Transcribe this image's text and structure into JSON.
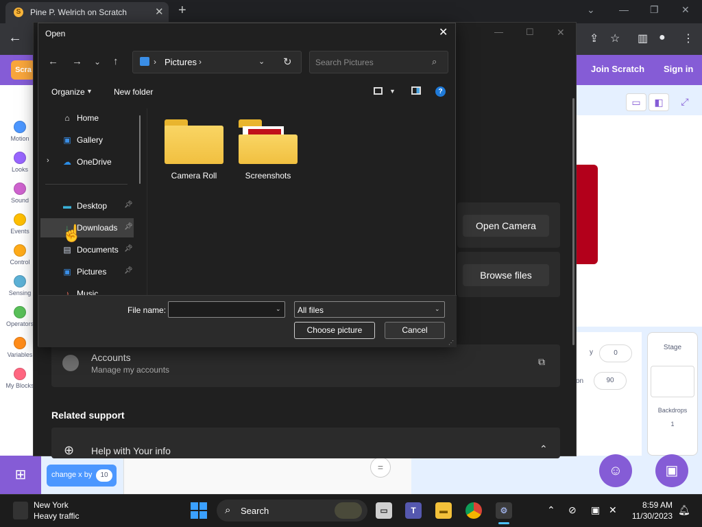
{
  "browser": {
    "tab_title": "Pine P. Welrich on Scratch",
    "favicon": "S",
    "new_tab": "+",
    "close_tab": "✕"
  },
  "scratch": {
    "join": "Join Scratch",
    "signin": "Sign in",
    "logo": "Scra",
    "categories": [
      {
        "label": "Motion",
        "color": "#4c97ff"
      },
      {
        "label": "Looks",
        "color": "#9966ff"
      },
      {
        "label": "Sound",
        "color": "#cf63cf"
      },
      {
        "label": "Events",
        "color": "#ffbf00"
      },
      {
        "label": "Control",
        "color": "#ffab19"
      },
      {
        "label": "Sensing",
        "color": "#5cb1d6"
      },
      {
        "label": "Operators",
        "color": "#59c059"
      },
      {
        "label": "Variables",
        "color": "#ff8c1a"
      },
      {
        "label": "My Blocks",
        "color": "#ff6680"
      }
    ],
    "sprite": {
      "y_label": "y",
      "y_value": "0",
      "dir_value": "90",
      "dir_label_fragment": "on"
    },
    "stage": {
      "title": "Stage",
      "backdrops_label": "Backdrops",
      "backdrops_count": "1"
    },
    "block": {
      "label": "change x by",
      "value": "10"
    },
    "zoom_reset": "="
  },
  "settings": {
    "open_camera": "Open Camera",
    "browse_files": "Browse files",
    "accounts_title": "Accounts",
    "accounts_sub": "Manage my accounts",
    "related_support": "Related support",
    "help_title": "Help with Your info"
  },
  "dialog": {
    "title": "Open",
    "location": "Pictures",
    "search_placeholder": "Search Pictures",
    "organize": "Organize",
    "new_folder": "New folder",
    "nav_items": [
      {
        "label": "Home",
        "icon": "home-icon",
        "glyph": "⌂"
      },
      {
        "label": "Gallery",
        "icon": "gallery-icon",
        "glyph": "▣"
      },
      {
        "label": "OneDrive",
        "icon": "cloud-icon",
        "glyph": "☁"
      },
      {
        "label": "Desktop",
        "icon": "desktop-icon",
        "glyph": "▬"
      },
      {
        "label": "Downloads",
        "icon": "download-icon",
        "glyph": "↓"
      },
      {
        "label": "Documents",
        "icon": "document-icon",
        "glyph": "▤"
      },
      {
        "label": "Pictures",
        "icon": "pictures-icon",
        "glyph": "▣"
      },
      {
        "label": "Music",
        "icon": "music-icon",
        "glyph": "♪"
      }
    ],
    "folders": [
      "Camera Roll",
      "Screenshots"
    ],
    "file_name_label": "File name:",
    "file_name_value": "",
    "filter": "All files",
    "choose_button": "Choose picture",
    "cancel_button": "Cancel"
  },
  "taskbar": {
    "weather_city": "New York",
    "weather_status": "Heavy traffic",
    "search": "Search",
    "time": "8:59 AM",
    "date": "11/30/2023"
  }
}
